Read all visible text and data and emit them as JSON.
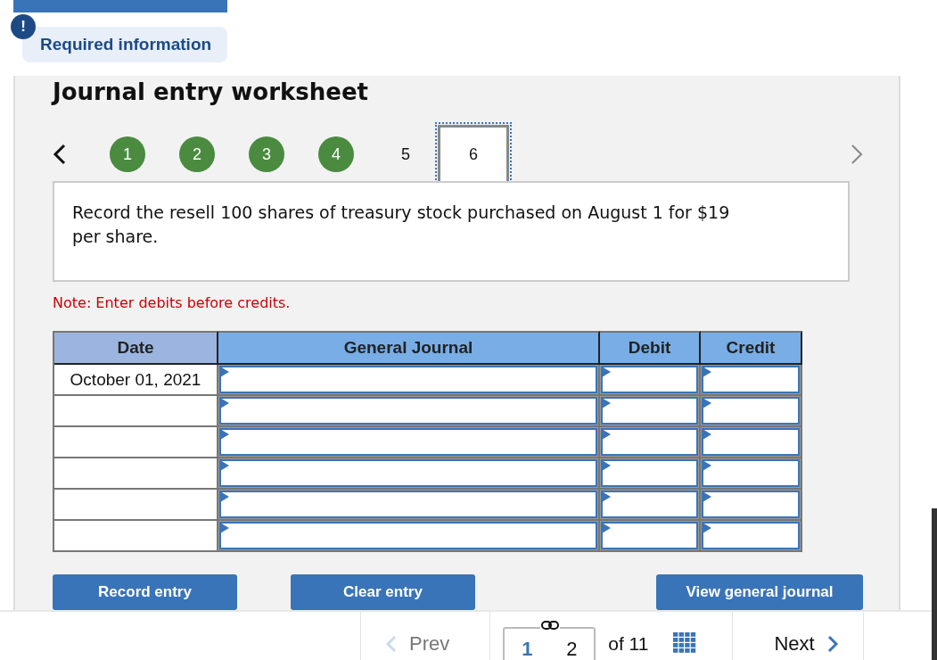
{
  "required_info": {
    "icon_text": "!",
    "label": "Required information"
  },
  "worksheet": {
    "title": "Journal entry worksheet",
    "steps": [
      {
        "label": "1",
        "completed": true,
        "selected": false
      },
      {
        "label": "2",
        "completed": true,
        "selected": false
      },
      {
        "label": "3",
        "completed": true,
        "selected": false
      },
      {
        "label": "4",
        "completed": true,
        "selected": false
      },
      {
        "label": "5",
        "completed": false,
        "selected": false
      },
      {
        "label": "6",
        "completed": false,
        "selected": true
      }
    ],
    "prompt": "Record the resell 100 shares of treasury stock purchased on August 1 for $19 per share.",
    "note": "Note: Enter debits before credits.",
    "table": {
      "columns": [
        "Date",
        "General Journal",
        "Debit",
        "Credit"
      ],
      "rows": [
        {
          "date": "October 01, 2021"
        },
        {},
        {},
        {},
        {},
        {}
      ]
    },
    "buttons": [
      "Record entry",
      "Clear entry",
      "View general journal"
    ]
  },
  "pagination": {
    "prev": "Prev",
    "pages": [
      {
        "label": "1",
        "selected": true
      },
      {
        "label": "2",
        "selected": false
      }
    ],
    "of": "of 11",
    "next": "Next"
  }
}
